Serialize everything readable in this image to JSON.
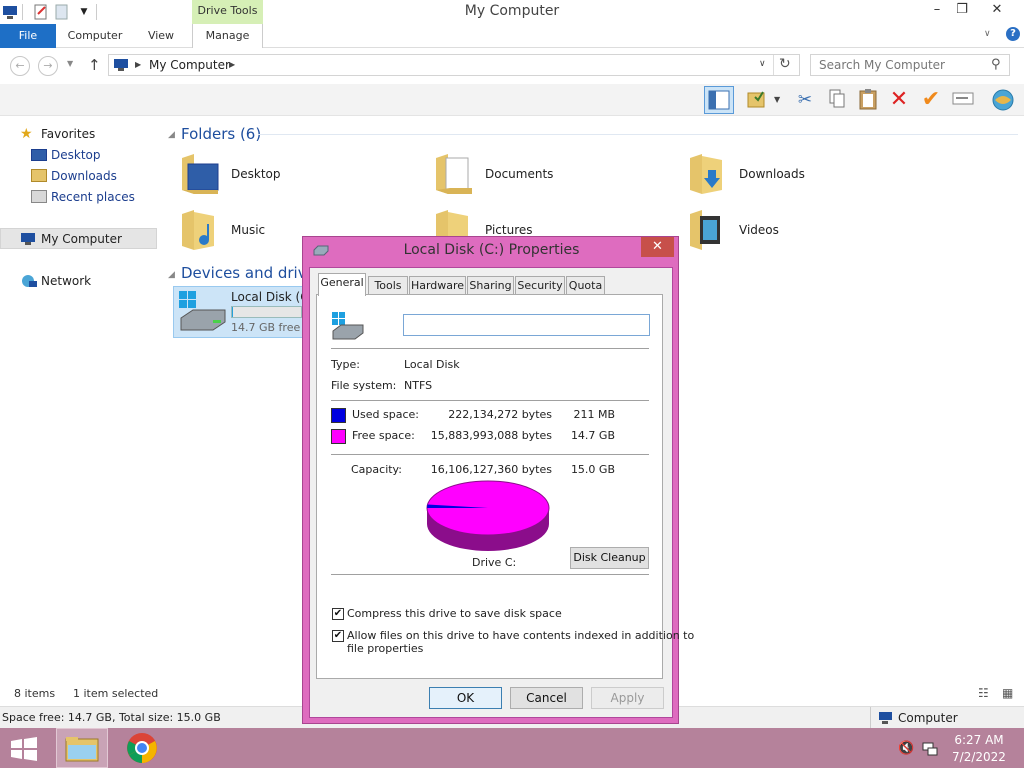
{
  "window": {
    "title": "My Computer",
    "drive_tools_label": "Drive Tools",
    "controls": {
      "minimize": "–",
      "restore": "❐",
      "close": "✕"
    }
  },
  "ribbon": {
    "tabs": [
      "File",
      "Computer",
      "View",
      "Manage"
    ],
    "help_glyph": "?"
  },
  "address_bar": {
    "path": "My Computer",
    "search_placeholder": "Search My Computer"
  },
  "sidebar": {
    "favorites_label": "Favorites",
    "favorites": [
      "Desktop",
      "Downloads",
      "Recent places"
    ],
    "computer_label": "My Computer",
    "network_label": "Network"
  },
  "content": {
    "folders_header": "Folders (6)",
    "folders": [
      "Desktop",
      "Documents",
      "Downloads",
      "Music",
      "Pictures",
      "Videos"
    ],
    "devices_header": "Devices and drives",
    "drive": {
      "name": "Local Disk (C:)",
      "free_text": "14.7 GB free of 15.0 GB",
      "used_fraction": 0.014
    }
  },
  "status": {
    "items": "8 items",
    "selected": "1 item selected",
    "space": "Space free: 14.7 GB, Total size: 15.0 GB",
    "location": "Computer"
  },
  "taskbar": {
    "time": "6:27 AM",
    "date": "7/2/2022"
  },
  "dialog": {
    "title": "Local Disk (C:) Properties",
    "tabs": [
      "General",
      "Tools",
      "Hardware",
      "Sharing",
      "Security",
      "Quota"
    ],
    "label_value": "",
    "type_label": "Type:",
    "type_value": "Local Disk",
    "fs_label": "File system:",
    "fs_value": "NTFS",
    "used_label": "Used space:",
    "used_bytes": "222,134,272 bytes",
    "used_size": "211 MB",
    "free_label": "Free space:",
    "free_bytes": "15,883,993,088 bytes",
    "free_size": "14.7 GB",
    "capacity_label": "Capacity:",
    "capacity_bytes": "16,106,127,360 bytes",
    "capacity_size": "15.0 GB",
    "drive_label": "Drive C:",
    "cleanup_label": "Disk Cleanup",
    "compress_label": "Compress this drive to save disk space",
    "index_label_1": "Allow files on this drive to have contents indexed in addition to",
    "index_label_2": "file properties",
    "compress_checked": true,
    "index_checked": true,
    "ok_label": "OK",
    "cancel_label": "Cancel",
    "apply_label": "Apply",
    "used_color": "#0000e0",
    "free_color": "#ff00ff",
    "used_fraction": 0.0138
  }
}
